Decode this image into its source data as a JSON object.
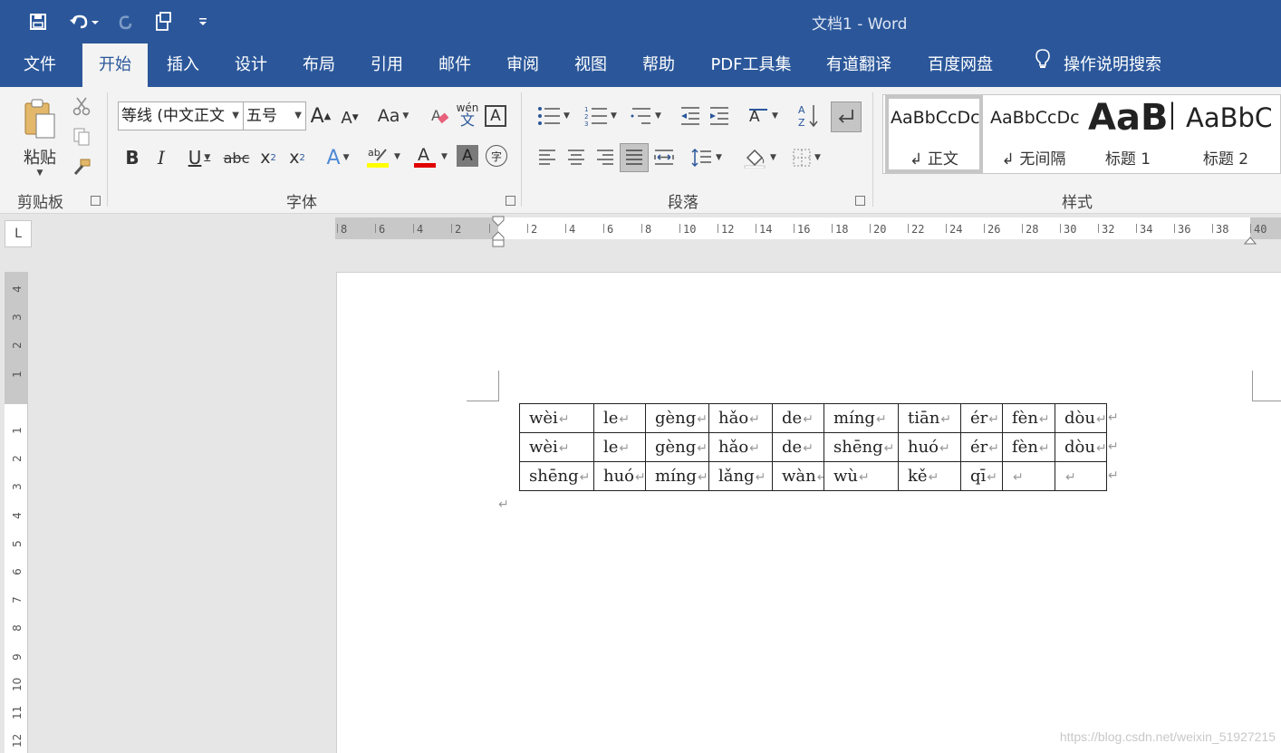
{
  "window": {
    "title": "文档1  -  Word"
  },
  "tabs": [
    "文件",
    "开始",
    "插入",
    "设计",
    "布局",
    "引用",
    "邮件",
    "审阅",
    "视图",
    "帮助",
    "PDF工具集",
    "有道翻译",
    "百度网盘"
  ],
  "tell_me": "操作说明搜索",
  "ribbon": {
    "clipboard": {
      "paste_label": "粘贴",
      "group_label": "剪贴板"
    },
    "font": {
      "font_name": "等线 (中文正文",
      "font_size": "五号",
      "group_label": "字体",
      "case_label": "Aa",
      "phonetic_top": "wén",
      "phonetic_bottom": "文"
    },
    "paragraph": {
      "group_label": "段落"
    },
    "styles": {
      "group_label": "样式",
      "items": [
        {
          "sample": "AaBbCcDc",
          "name": "↲ 正文"
        },
        {
          "sample": "AaBbCcDc",
          "name": "↲ 无间隔"
        },
        {
          "sample": "AaBl",
          "name": "标题 1"
        },
        {
          "sample": "AaBbC",
          "name": "标题 2"
        }
      ]
    }
  },
  "hruler_labels": [
    "8",
    "6",
    "4",
    "2",
    "",
    "2",
    "4",
    "6",
    "8",
    "10",
    "12",
    "14",
    "16",
    "18",
    "20",
    "22",
    "24",
    "26",
    "28",
    "30",
    "32",
    "34",
    "36",
    "38",
    "40"
  ],
  "vruler_labels": [
    "4",
    "3",
    "2",
    "1",
    "",
    "1",
    "2",
    "3",
    "4",
    "5",
    "6",
    "7",
    "8",
    "9",
    "10",
    "11",
    "12"
  ],
  "table": {
    "rows": [
      [
        "wèi",
        "le",
        "gèng",
        "hǎo",
        "de",
        "míng",
        "tiān",
        "ér",
        "fèn",
        "dòu"
      ],
      [
        "wèi",
        "le",
        "gèng",
        "hǎo",
        "de",
        "shēng",
        "huó",
        "ér",
        "fèn",
        "dòu"
      ],
      [
        "shēng",
        "huó",
        "míng",
        "lǎng",
        "wàn",
        "wù",
        "kě",
        "qī",
        "",
        ""
      ]
    ],
    "mark": "↵"
  },
  "watermark": "https://blog.csdn.net/weixin_51927215"
}
